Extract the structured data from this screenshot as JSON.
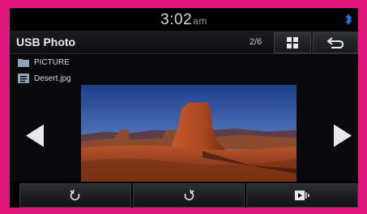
{
  "status": {
    "time": "3:02",
    "ampm": "am",
    "bluetooth_icon": "bluetooth-icon"
  },
  "header": {
    "title": "USB Photo",
    "pager": "2/6",
    "grid_icon": "grid-view-icon",
    "back_icon": "back-arrow-icon"
  },
  "sidebar": {
    "items": [
      {
        "label": "PICTURE",
        "icon": "folder-icon"
      },
      {
        "label": "Desert.jpg",
        "icon": "image-file-icon"
      }
    ]
  },
  "main": {
    "prev_icon": "previous-arrow-icon",
    "next_icon": "next-arrow-icon"
  },
  "bottom": {
    "buttons": [
      {
        "icon": "rotate-left-icon"
      },
      {
        "icon": "rotate-right-icon"
      },
      {
        "icon": "slideshow-icon"
      }
    ]
  },
  "colors": {
    "bezel": "#e0167a",
    "background": "#050607",
    "text": "#e9ebed"
  }
}
